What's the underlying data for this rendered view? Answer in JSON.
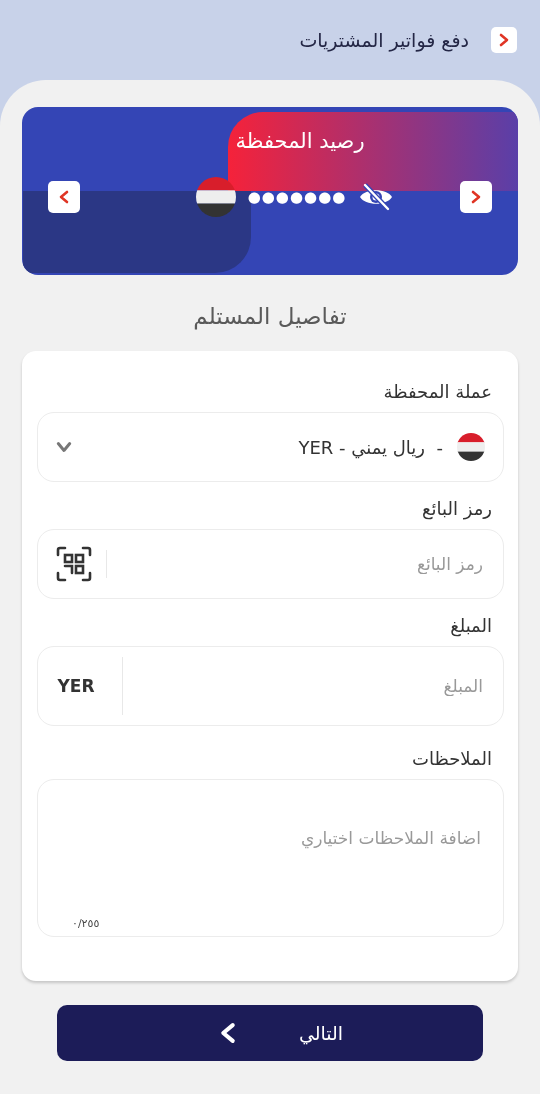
{
  "header": {
    "title": "دفع فواتير المشتريات"
  },
  "wallet_card": {
    "title": "رصيد المحفظة",
    "balance": "●●●●●●●",
    "balance_hidden": true
  },
  "section_title": "تفاصيل المستلم",
  "form": {
    "fields": [
      {
        "kind": "select",
        "label": "عملة المحفظة",
        "value": "-  ريال يمني - YER"
      },
      {
        "kind": "scan",
        "label": "رمز البائع",
        "placeholder": "رمز البائع"
      },
      {
        "kind": "amount",
        "label": "المبلغ",
        "placeholder": "المبلغ",
        "suffix": "YER"
      },
      {
        "kind": "notes",
        "label": "الملاحظات",
        "placeholder": "اضافة الملاحظات اختياري",
        "counter": "٠/٢٥٥"
      }
    ]
  },
  "next_button": {
    "label": "التالي"
  }
}
